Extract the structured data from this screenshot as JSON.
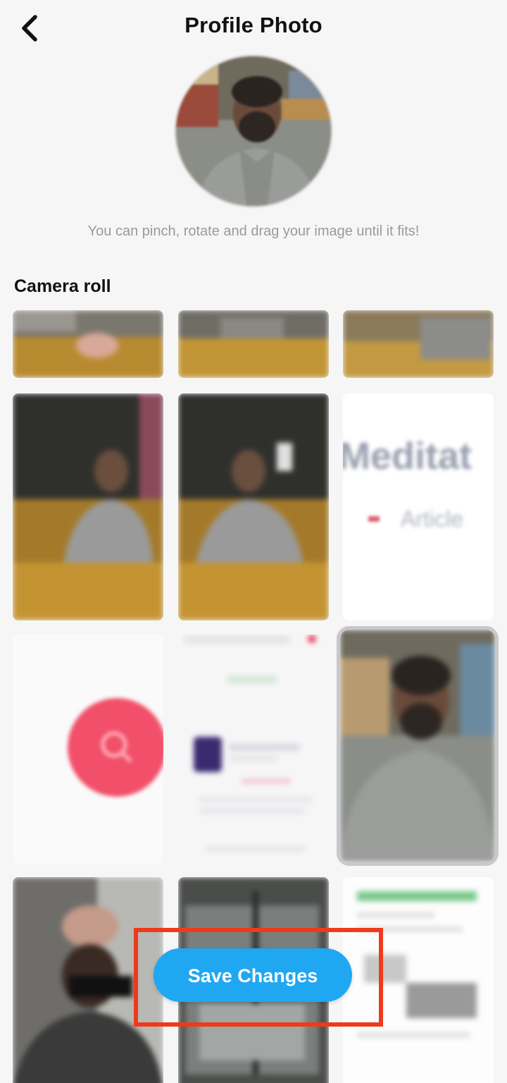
{
  "header": {
    "title": "Profile Photo",
    "back_icon": "chevron-left-icon"
  },
  "hint": {
    "text": "You can pinch, rotate and drag your image until it fits!"
  },
  "camera_roll": {
    "title": "Camera roll",
    "tiles": [
      {
        "description": "partial photo, desk row"
      },
      {
        "description": "partial photo, desk row"
      },
      {
        "description": "partial photo, desk row"
      },
      {
        "description": "man seated at desk"
      },
      {
        "description": "man seated at desk"
      },
      {
        "description": "screenshot with text"
      },
      {
        "description": "screenshot with red search button"
      },
      {
        "description": "screenshot of app page"
      },
      {
        "description": "portrait of bearded man"
      },
      {
        "description": "man with sunglasses selfie"
      },
      {
        "description": "outdoor photo"
      },
      {
        "description": "screenshot of document"
      }
    ],
    "blurred_text": {
      "heading_fragment": "Meditat",
      "sub_fragment": "Article"
    }
  },
  "footer": {
    "save_label": "Save Changes"
  },
  "colors": {
    "save_button": "#1fa7f2",
    "highlight": "#ee3a1a",
    "search_button": "#f2506a"
  }
}
